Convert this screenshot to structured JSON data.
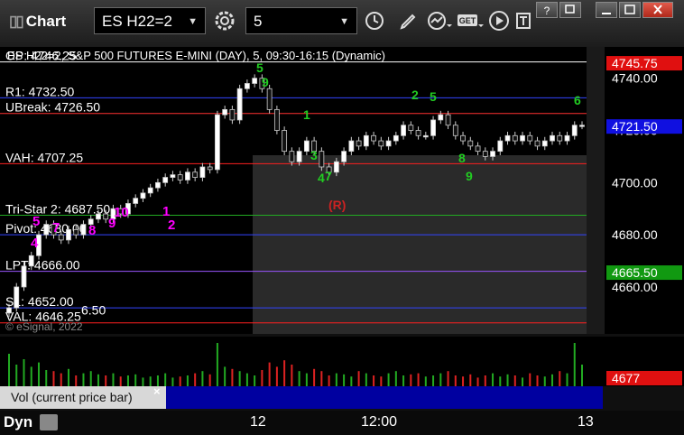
{
  "app": {
    "title": "Chart"
  },
  "toolbar": {
    "symbol": "ES H22=2",
    "interval": "5",
    "get_label": "GET"
  },
  "chart_info": "ES H22=2, S&P 500 FUTURES E-MINI (DAY), 5, 09:30-16:15 (Dynamic)",
  "copyright": "© eSignal, 2022",
  "colors": {
    "bg": "#000000",
    "panel": "#2a2a2a",
    "red": "#ff0000",
    "blue": "#0000ff",
    "green": "#00aa00",
    "magenta": "#ff00ff"
  },
  "chart_data": {
    "type": "candlestick",
    "ylim": [
      4642,
      4752
    ],
    "y_ticks": [
      "4740.00",
      "4720.00",
      "4700.00",
      "4680.00",
      "4660.00"
    ],
    "x_ticks": [
      "12",
      "12:00",
      "13"
    ],
    "levels": [
      {
        "label": "OP: 4746.25",
        "value": 4746.25,
        "color": "#ffffff"
      },
      {
        "label": "R1: 4732.50",
        "value": 4732.5,
        "color": "#3344ff"
      },
      {
        "label": "UBreak: 4726.50",
        "value": 4726.5,
        "color": "#ff3030"
      },
      {
        "label": "VAH: 4707.25",
        "value": 4707.25,
        "color": "#ff2020"
      },
      {
        "label": "Tri-Star 2: 4687.50",
        "value": 4687.5,
        "color": "#22aa22"
      },
      {
        "label": "Pivot: 4680.00",
        "value": 4680.0,
        "color": "#3344ff"
      },
      {
        "label": "LPT: 4666.00",
        "value": 4666.0,
        "color": "#9955ff"
      },
      {
        "label": "S1: 4652.00",
        "value": 4652.0,
        "color": "#3344ff"
      },
      {
        "label": "VAL: 4646.25",
        "value": 4646.25,
        "color": "#ff2020"
      }
    ],
    "extra_labels": [
      {
        "label": "6.50",
        "color": "#ffffff"
      }
    ],
    "price_tags": [
      {
        "text": "4745.75",
        "value": 4745.75,
        "color": "#e01010"
      },
      {
        "text": "4721.50",
        "value": 4721.5,
        "color": "#1010e0"
      },
      {
        "text": "4665.50",
        "value": 4665.5,
        "color": "#119911"
      }
    ],
    "closes": [
      4652,
      4660,
      4668,
      4672,
      4680,
      4684,
      4680,
      4678,
      4682,
      4680,
      4684,
      4686,
      4688,
      4686,
      4690,
      4688,
      4692,
      4694,
      4696,
      4698,
      4700,
      4702,
      4703,
      4701,
      4704,
      4702,
      4706,
      4705,
      4726,
      4728,
      4724,
      4736,
      4738,
      4740,
      4736,
      4728,
      4720,
      4712,
      4708,
      4712,
      4716,
      4712,
      4706,
      4704,
      4708,
      4712,
      4716,
      4714,
      4718,
      4716,
      4714,
      4716,
      4718,
      4722,
      4720,
      4718,
      4718,
      4724,
      4726,
      4722,
      4718,
      4716,
      4714,
      4712,
      4710,
      4712,
      4716,
      4718,
      4716,
      4718,
      4716,
      4714,
      4716,
      4718,
      4716,
      4718,
      4722,
      4722
    ],
    "td_labels": [
      {
        "text": "5",
        "color": "#ff00ff"
      },
      {
        "text": "7",
        "color": "#ff00ff"
      },
      {
        "text": "8",
        "color": "#ff00ff"
      },
      {
        "text": "9",
        "color": "#ff00ff"
      },
      {
        "text": "10",
        "color": "#ff00ff"
      },
      {
        "text": "1",
        "color": "#ff00ff"
      },
      {
        "text": "2",
        "color": "#ff00ff"
      },
      {
        "text": "4",
        "color": "#ff00ff"
      },
      {
        "text": "5",
        "color": "#22cc22"
      },
      {
        "text": "9",
        "color": "#22cc22"
      },
      {
        "text": "1",
        "color": "#22cc22"
      },
      {
        "text": "3",
        "color": "#22cc22"
      },
      {
        "text": "4",
        "color": "#22cc22"
      },
      {
        "text": "7",
        "color": "#22cc22"
      },
      {
        "text": "8",
        "color": "#22cc22"
      },
      {
        "text": "9",
        "color": "#22cc22"
      },
      {
        "text": "2",
        "color": "#22cc22"
      },
      {
        "text": "5",
        "color": "#22cc22"
      },
      {
        "text": "6",
        "color": "#22cc22"
      },
      {
        "text": "(R)",
        "color": "#cc2222"
      }
    ]
  },
  "volume": {
    "label": "Vol (current price bar)",
    "tag": "4677",
    "bars": [
      30,
      20,
      25,
      18,
      22,
      15,
      14,
      12,
      16,
      10,
      12,
      14,
      11,
      10,
      12,
      9,
      10,
      11,
      8,
      9,
      10,
      12,
      8,
      9,
      10,
      12,
      14,
      11,
      40,
      18,
      16,
      14,
      12,
      10,
      15,
      22,
      18,
      24,
      20,
      14,
      12,
      16,
      14,
      10,
      12,
      11,
      9,
      14,
      12,
      10,
      9,
      12,
      14,
      10,
      11,
      12,
      9,
      10,
      12,
      14,
      10,
      9,
      11,
      8,
      10,
      12,
      9,
      11,
      10,
      8,
      12,
      10,
      9,
      11,
      14,
      12,
      40,
      20
    ]
  },
  "bottom": {
    "label": "Dyn"
  }
}
